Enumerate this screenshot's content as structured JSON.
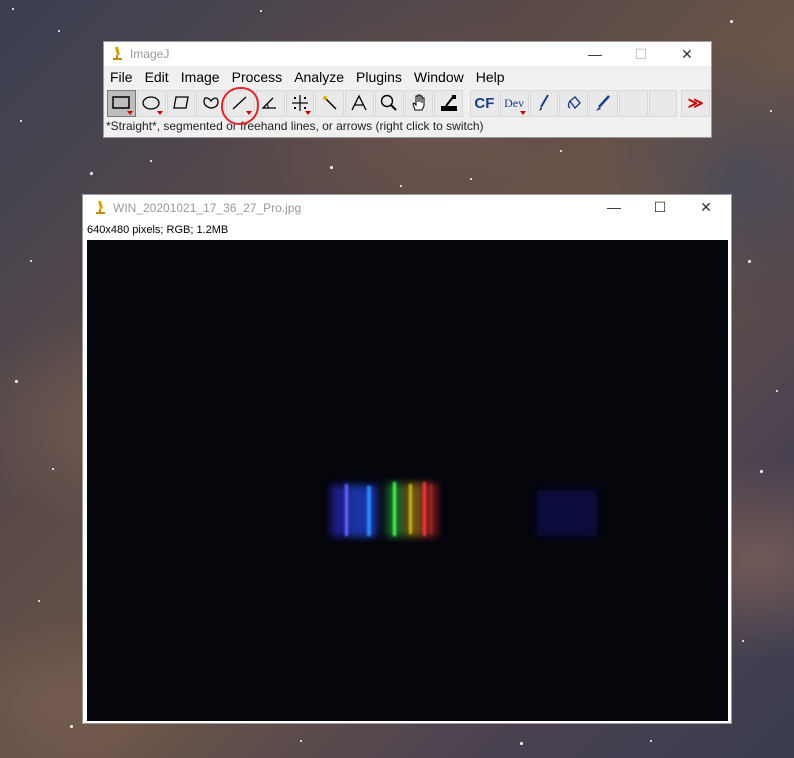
{
  "imagej": {
    "title": "ImageJ",
    "menu": [
      "File",
      "Edit",
      "Image",
      "Process",
      "Analyze",
      "Plugins",
      "Window",
      "Help"
    ],
    "tools": [
      {
        "name": "rectangle-tool",
        "icon": "rectangle-icon"
      },
      {
        "name": "oval-tool",
        "icon": "oval-icon"
      },
      {
        "name": "polygon-tool",
        "icon": "polygon-icon"
      },
      {
        "name": "freehand-tool",
        "icon": "freehand-icon"
      },
      {
        "name": "line-tool",
        "icon": "line-icon"
      },
      {
        "name": "angle-tool",
        "icon": "angle-icon"
      },
      {
        "name": "point-tool",
        "icon": "point-icon"
      },
      {
        "name": "wand-tool",
        "icon": "wand-icon"
      },
      {
        "name": "text-tool",
        "icon": "text-icon"
      },
      {
        "name": "magnifier-tool",
        "icon": "magnifier-icon"
      },
      {
        "name": "scroll-tool",
        "icon": "hand-icon"
      },
      {
        "name": "color-picker-tool",
        "icon": "color-picker-icon"
      },
      {
        "name": "cf-tool",
        "label": "CF"
      },
      {
        "name": "dev-tool",
        "label": "Dev"
      },
      {
        "name": "brush-tool",
        "icon": "brush-icon"
      },
      {
        "name": "flood-fill-tool",
        "icon": "flood-fill-icon"
      },
      {
        "name": "pencil-tool",
        "icon": "pencil-icon"
      },
      {
        "name": "empty-slot-1"
      },
      {
        "name": "empty-slot-2"
      },
      {
        "name": "more-tools",
        "label": "≫"
      }
    ],
    "status": "*Straight*, segmented or freehand lines, or arrows (right click to switch)"
  },
  "image_window": {
    "title": "WIN_20201021_17_36_27_Pro.jpg",
    "info": "640x480 pixels; RGB; 1.2MB"
  },
  "window_controls": {
    "minimize": "—",
    "maximize": "☐",
    "close": "✕"
  },
  "colors": {
    "annotation": "#e3242b",
    "cf_text": "#1a3f8a",
    "canvas": "#05050c"
  }
}
